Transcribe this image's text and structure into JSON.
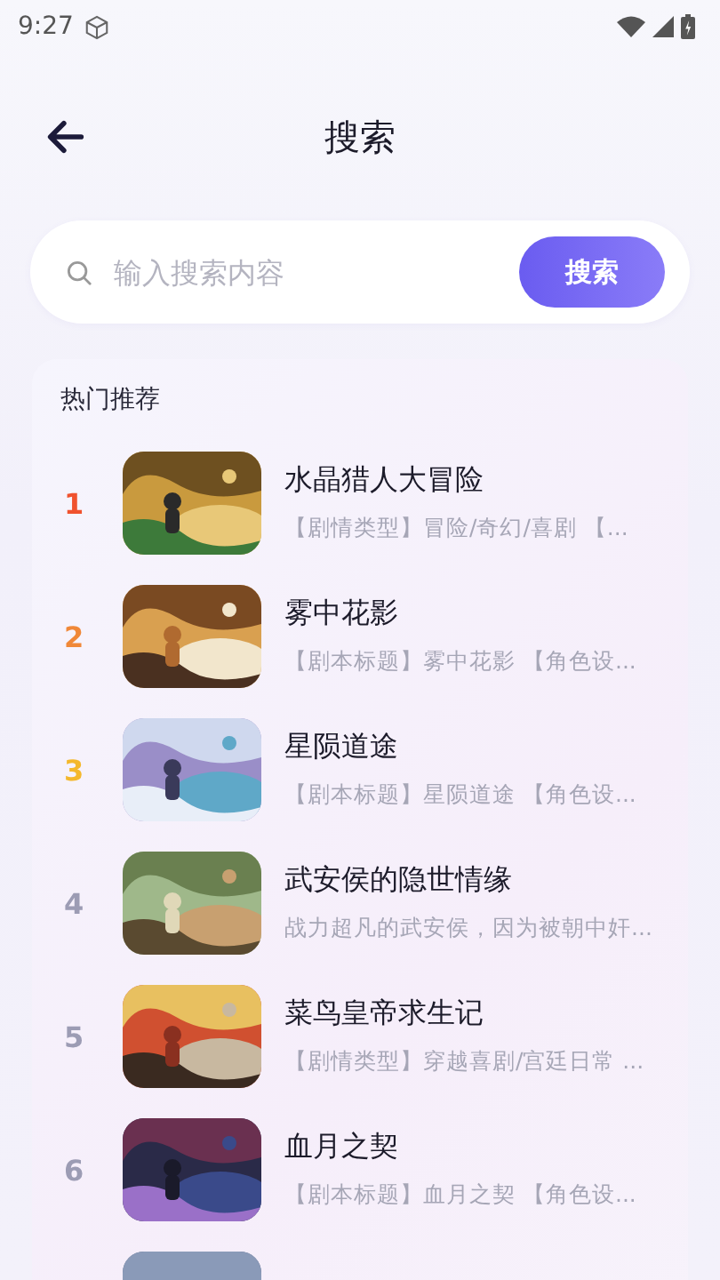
{
  "status_bar": {
    "time": "9:27"
  },
  "header": {
    "title": "搜索"
  },
  "search": {
    "placeholder": "输入搜索内容",
    "button": "搜索"
  },
  "hot": {
    "title": "热门推荐",
    "items": [
      {
        "rank": "1",
        "color": "#f0522e",
        "title": "水晶猎人大冒险",
        "description": "【剧情类型】冒险/奇幻/喜剧 【...",
        "kind": "picture"
      },
      {
        "rank": "2",
        "color": "#f08838",
        "title": "雾中花影",
        "description": "【剧本标题】雾中花影 【角色设...",
        "kind": "picture"
      },
      {
        "rank": "3",
        "color": "#f4b82c",
        "title": "星陨道途",
        "description": "【剧本标题】星陨道途 【角色设...",
        "kind": "picture"
      },
      {
        "rank": "4",
        "color": "#9c9cb4",
        "title": "武安侯的隐世情缘",
        "description": "战力超凡的武安侯，因为被朝中奸...",
        "kind": "picture"
      },
      {
        "rank": "5",
        "color": "#9c9cb4",
        "title": "菜鸟皇帝求生记",
        "description": "【剧情类型】穿越喜剧/宫廷日常 ...",
        "kind": "picture"
      },
      {
        "rank": "6",
        "color": "#9c9cb4",
        "title": "血月之契",
        "description": "【剧本标题】血月之契 【角色设...",
        "kind": "picture"
      }
    ]
  }
}
